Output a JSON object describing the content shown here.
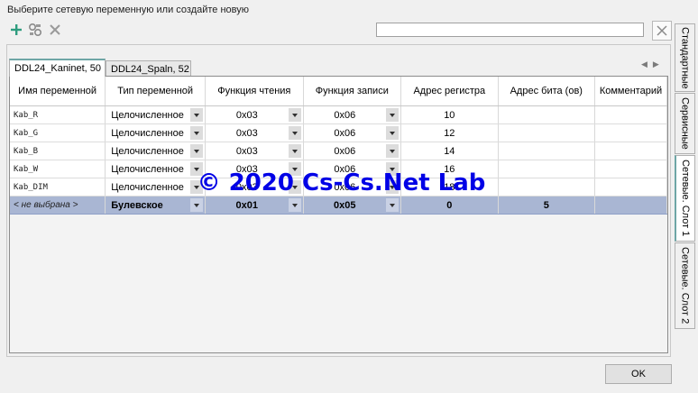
{
  "dialog": {
    "title": "Выберите сетевую переменную или создайте новую"
  },
  "toolbar": {
    "add": "add-icon",
    "link": "link-icon",
    "delete": "delete-icon"
  },
  "search": {
    "value": "",
    "placeholder": ""
  },
  "tabs": [
    {
      "label": "DDL24_Kaninet, 50",
      "active": true
    },
    {
      "label": "DDL24_Spaln, 52",
      "active": false
    }
  ],
  "columns": [
    "Имя переменной",
    "Тип переменной",
    "Функция чтения",
    "Функция записи",
    "Адрес регистра",
    "Адрес бита (ов)",
    "Комментарий"
  ],
  "rows": [
    {
      "name": "Kab_R",
      "type": "Целочисленное",
      "read": "0x03",
      "write": "0x06",
      "reg": "10",
      "bit": "",
      "comment": ""
    },
    {
      "name": "Kab_G",
      "type": "Целочисленное",
      "read": "0x03",
      "write": "0x06",
      "reg": "12",
      "bit": "",
      "comment": ""
    },
    {
      "name": "Kab_B",
      "type": "Целочисленное",
      "read": "0x03",
      "write": "0x06",
      "reg": "14",
      "bit": "",
      "comment": ""
    },
    {
      "name": "Kab_W",
      "type": "Целочисленное",
      "read": "0x03",
      "write": "0x06",
      "reg": "16",
      "bit": "",
      "comment": ""
    },
    {
      "name": "Kab_DIM",
      "type": "Целочисленное",
      "read": "0x03",
      "write": "0x06",
      "reg": "18",
      "bit": "",
      "comment": ""
    },
    {
      "name": "< не выбрана >",
      "type": "Булевское",
      "read": "0x01",
      "write": "0x05",
      "reg": "0",
      "bit": "5",
      "comment": ""
    }
  ],
  "watermark": "© 2020 Cs-Cs.Net Lab",
  "side_tabs": [
    {
      "label": "Стандартные",
      "active": false
    },
    {
      "label": "Сервисные",
      "active": false
    },
    {
      "label": "Сетевые. Слот 1",
      "active": true
    },
    {
      "label": "Сетевые. Слот 2",
      "active": false
    }
  ],
  "buttons": {
    "ok": "OK"
  },
  "colors": {
    "selected_row": "#a9b6d3",
    "watermark": "#0000e6",
    "accent": "#6ea6a6",
    "add_icon": "#2e9c7e"
  }
}
